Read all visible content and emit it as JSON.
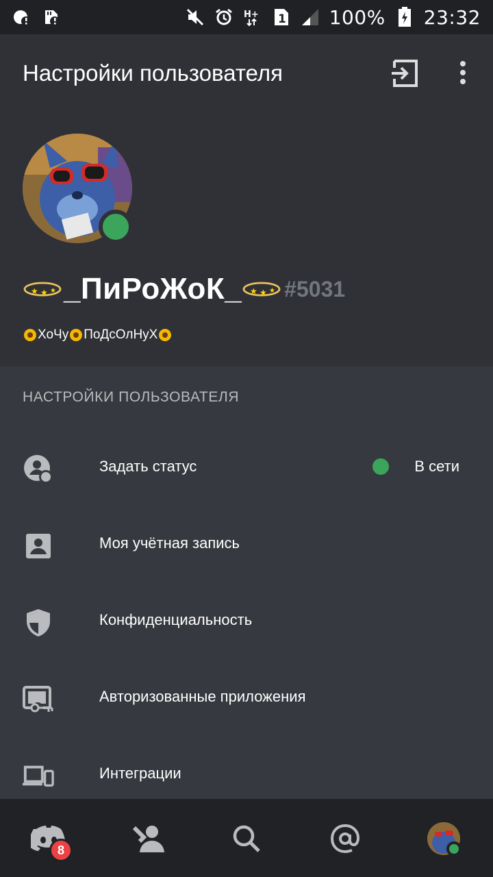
{
  "status_bar": {
    "battery": "100%",
    "time": "23:32",
    "network": "H+",
    "sim": "1",
    "left_icons": [
      "data-saver-alert-icon",
      "sd-card-alert-icon"
    ],
    "right_icons": [
      "mute-icon",
      "alarm-icon",
      "network-type-icon",
      "sim-icon",
      "signal-icon",
      "battery-icon"
    ]
  },
  "app_bar": {
    "title": "Настройки пользователя",
    "actions": [
      "logout-icon",
      "more-vert-icon"
    ]
  },
  "profile": {
    "username": "_ПиРоЖоК_",
    "discriminator": "#5031",
    "custom_status": "🌻ХоЧу🌻ПоДсОлНуХ🌻",
    "custom_status_parts": [
      "ХоЧу",
      "ПоДсОлНуХ"
    ],
    "online_status_color": "#3ba55c"
  },
  "settings": {
    "section_title": "НАСТРОЙКИ ПОЛЬЗОВАТЕЛЯ",
    "items": [
      {
        "label": "Задать статус",
        "icon": "set-status-icon",
        "value": "В сети"
      },
      {
        "label": "Моя учётная запись",
        "icon": "account-icon"
      },
      {
        "label": "Конфиденциальность",
        "icon": "shield-icon"
      },
      {
        "label": "Авторизованные приложения",
        "icon": "authorized-apps-icon"
      },
      {
        "label": "Интеграции",
        "icon": "devices-icon"
      }
    ]
  },
  "bottom_nav": {
    "tabs": [
      "home-icon",
      "friends-icon",
      "search-icon",
      "mentions-icon",
      "profile-avatar"
    ],
    "badge": "8"
  },
  "colors": {
    "background": "#36393f",
    "header_bg": "#2f3136",
    "nav_bg": "#202225",
    "online": "#3ba55c",
    "badge": "#ed4245"
  }
}
